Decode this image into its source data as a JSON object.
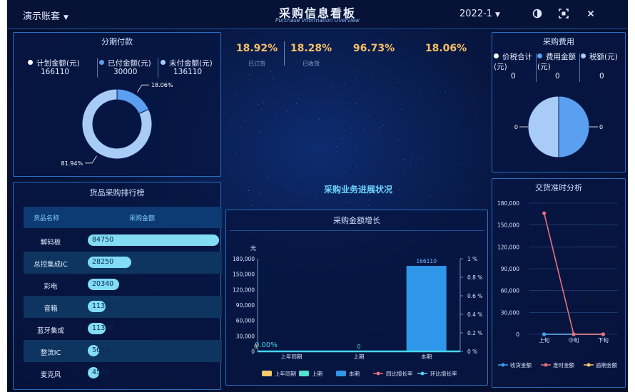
{
  "header": {
    "account": "演示账套",
    "title": "采购信息看板",
    "subtitle": "Purchase Information Overview",
    "period": "2022-1"
  },
  "installment": {
    "title": "分期付款",
    "legend": [
      {
        "label": "计划金额(元)",
        "value": "166110",
        "color": "#ffffff"
      },
      {
        "label": "已付金额(元)",
        "value": "30000",
        "color": "#5b9ff0"
      },
      {
        "label": "未付金额(元)",
        "value": "136110",
        "color": "#a9ccf7"
      }
    ],
    "slices": [
      {
        "label": "18.06%",
        "percent": 18.06,
        "color": "#5b9ff0"
      },
      {
        "label": "81.94%",
        "percent": 81.94,
        "color": "#a9ccf7"
      }
    ]
  },
  "kpis": [
    {
      "value": "18.92%",
      "label": "已订货"
    },
    {
      "value": "18.28%",
      "label": "已收货"
    },
    {
      "value": "96.73%",
      "label": ""
    },
    {
      "value": "18.06%",
      "label": ""
    }
  ],
  "cost": {
    "title": "采购费用",
    "legend": [
      {
        "label": "价税合计(元)",
        "value": "0",
        "color": "#ffffff"
      },
      {
        "label": "费用金额(元)",
        "value": "0",
        "color": "#5b9ff0"
      },
      {
        "label": "税额(元)",
        "value": "0",
        "color": "#a9ccf7"
      }
    ],
    "pie_left_label": "0",
    "pie_right_label": "0",
    "slices": [
      {
        "percent": 50,
        "color": "#5b9ff0"
      },
      {
        "percent": 50,
        "color": "#a9ccf7"
      }
    ]
  },
  "ranking": {
    "title": "货品采购排行榜",
    "col_name": "货品名称",
    "col_amount": "采购金额",
    "max": 84750,
    "rows": [
      {
        "name": "解码板",
        "amount": 84750,
        "label": "84750"
      },
      {
        "name": "总控集成IC",
        "amount": 28250,
        "label": "28250"
      },
      {
        "name": "彩电",
        "amount": 20340,
        "label": "20340"
      },
      {
        "name": "音箱",
        "amount": 11300,
        "label": "11300"
      },
      {
        "name": "蓝牙集成",
        "amount": 11300,
        "label": "11300"
      },
      {
        "name": "整流IC",
        "amount": 5650,
        "label": "5650"
      },
      {
        "name": "麦克风",
        "amount": 4520,
        "label": "4520"
      }
    ]
  },
  "progress_title": "采购业务进展状况",
  "growth": {
    "title": "采购金额增长",
    "unit": "元",
    "legend": [
      "上年同期",
      "上期",
      "本期",
      "同比增长率",
      "环比增长率"
    ],
    "legend_colors": [
      "#f5c96a",
      "#52e3cf",
      "#2f97ea",
      "#e8707a",
      "#45d4f0"
    ],
    "rate_label": "0.00%"
  },
  "delivery": {
    "title": "交货准时分析",
    "legend": [
      "收货金额",
      "准时金额",
      "逾期金额"
    ],
    "legend_colors": [
      "#3aa0f0",
      "#e8707a",
      "#f5c96a"
    ]
  },
  "chart_data": [
    {
      "type": "pie",
      "title": "分期付款",
      "categories": [
        "已付金额(元)",
        "未付金额(元)"
      ],
      "values": [
        30000,
        136110
      ],
      "labels": [
        "18.06%",
        "81.94%"
      ]
    },
    {
      "type": "bar",
      "title": "货品采购排行榜",
      "categories": [
        "解码板",
        "总控集成IC",
        "彩电",
        "音箱",
        "蓝牙集成",
        "整流IC",
        "麦克风"
      ],
      "values": [
        84750,
        28250,
        20340,
        11300,
        11300,
        5650,
        4520
      ]
    },
    {
      "type": "bar",
      "title": "采购金额增长",
      "categories": [
        "上年同期",
        "上期",
        "本期"
      ],
      "series": [
        {
          "name": "上年同期",
          "values": [
            0,
            null,
            null
          ]
        },
        {
          "name": "上期",
          "values": [
            null,
            0,
            null
          ]
        },
        {
          "name": "本期",
          "values": [
            null,
            null,
            166110
          ]
        },
        {
          "name": "同比增长率",
          "values": [
            0,
            0,
            0
          ]
        },
        {
          "name": "环比增长率",
          "values": [
            0,
            0,
            0
          ]
        }
      ],
      "ylabel": "元",
      "ylim": [
        0,
        180000
      ],
      "yticks": [
        "0",
        "30,000",
        "60,000",
        "90,000",
        "120,000",
        "150,000",
        "180,000"
      ],
      "y2lim": [
        0,
        1
      ],
      "y2ticks": [
        "0 %",
        "0.2 %",
        "0.4 %",
        "0.6 %",
        "0.8 %",
        "1 %"
      ],
      "bar_labels": [
        "0",
        "0",
        "166110"
      ]
    },
    {
      "type": "line",
      "title": "交货准时分析",
      "categories": [
        "上旬",
        "中旬",
        "下旬"
      ],
      "series": [
        {
          "name": "收货金额",
          "values": [
            0,
            0,
            0
          ]
        },
        {
          "name": "准时金额",
          "values": [
            166110,
            0,
            0
          ]
        },
        {
          "name": "逾期金额",
          "values": [
            0,
            0,
            0
          ]
        }
      ],
      "ylim": [
        0,
        180000
      ],
      "yticks": [
        "0",
        "30,000",
        "60,000",
        "90,000",
        "120,000",
        "150,000",
        "180,000"
      ]
    }
  ]
}
